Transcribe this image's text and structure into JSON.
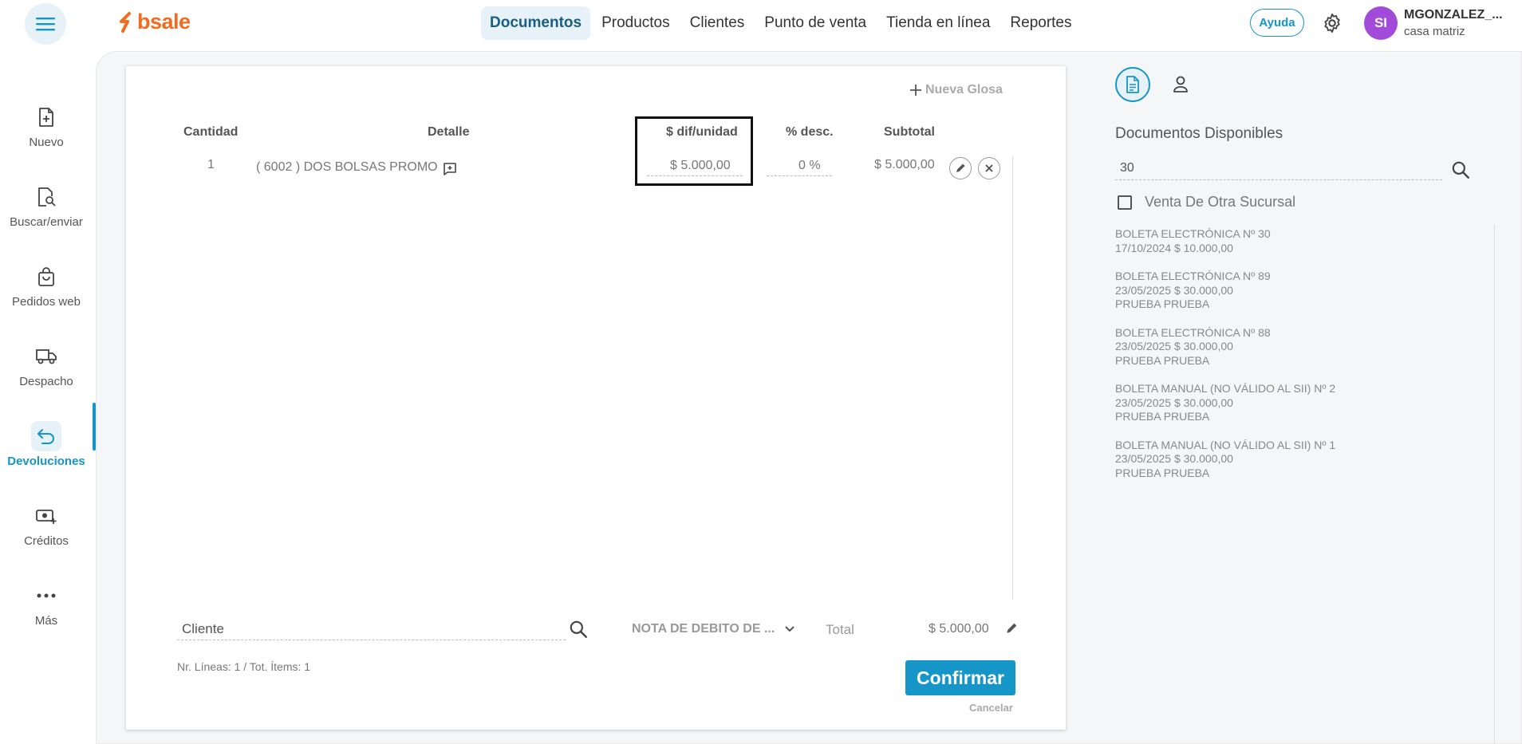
{
  "header": {
    "logo_text": "bsale",
    "nav": [
      "Documentos",
      "Productos",
      "Clientes",
      "Punto de venta",
      "Tienda en línea",
      "Reportes"
    ],
    "help_label": "Ayuda",
    "avatar_initials": "SI",
    "user_name": "MGONZALEZ_...",
    "user_branch": "casa matriz"
  },
  "sidebar": {
    "items": [
      {
        "label": "Nuevo",
        "icon": "file-plus-icon"
      },
      {
        "label": "Buscar/enviar",
        "icon": "file-search-icon"
      },
      {
        "label": "Pedidos web",
        "icon": "shopping-bag-icon"
      },
      {
        "label": "Despacho",
        "icon": "truck-icon"
      },
      {
        "label": "Devoluciones",
        "icon": "return-arrow-icon"
      },
      {
        "label": "Créditos",
        "icon": "money-plus-icon"
      },
      {
        "label": "Más",
        "icon": "more-dots-icon"
      }
    ],
    "active": "Devoluciones"
  },
  "document": {
    "nueva_glosa": "Nueva Glosa",
    "columns": {
      "cantidad": "Cantidad",
      "detalle": "Detalle",
      "dif_unidad": "$ dif/unidad",
      "desc": "% desc.",
      "subtotal": "Subtotal"
    },
    "row": {
      "cantidad": "1",
      "detalle": "( 6002 ) DOS BOLSAS PROMO",
      "dif_unidad": "$ 5.000,00",
      "desc": "0 %",
      "subtotal": "$ 5.000,00"
    },
    "cliente_placeholder": "Cliente",
    "doc_type": "NOTA DE DEBITO DE ...",
    "total_label": "Total",
    "total_value": "$ 5.000,00",
    "lines_info": "Nr. Líneas: 1 / Tot. Ítems: 1",
    "confirm_label": "Confirmar",
    "cancel_label": "Cancelar"
  },
  "right_panel": {
    "title": "Documentos Disponibles",
    "search_value": "30",
    "checkbox_label": "Venta De Otra Sucursal",
    "documents": [
      {
        "line1": "BOLETA ELECTRÓNICA Nº 30",
        "line2": "17/10/2024 $ 10.000,00",
        "line3": ""
      },
      {
        "line1": "BOLETA ELECTRÓNICA Nº 89",
        "line2": "23/05/2025 $ 30.000,00",
        "line3": "PRUEBA PRUEBA"
      },
      {
        "line1": "BOLETA ELECTRÓNICA Nº 88",
        "line2": "23/05/2025 $ 30.000,00",
        "line3": "PRUEBA PRUEBA"
      },
      {
        "line1": "BOLETA MANUAL (NO VÁLIDO AL SII) Nº 2",
        "line2": "23/05/2025 $ 30.000,00",
        "line3": "PRUEBA PRUEBA"
      },
      {
        "line1": "BOLETA MANUAL (NO VÁLIDO AL SII) Nº 1",
        "line2": "23/05/2025 $ 30.000,00",
        "line3": "PRUEBA PRUEBA"
      }
    ]
  },
  "colors": {
    "brand": "#f26b21",
    "accent": "#1695c9",
    "avatar": "#a24bd9"
  }
}
